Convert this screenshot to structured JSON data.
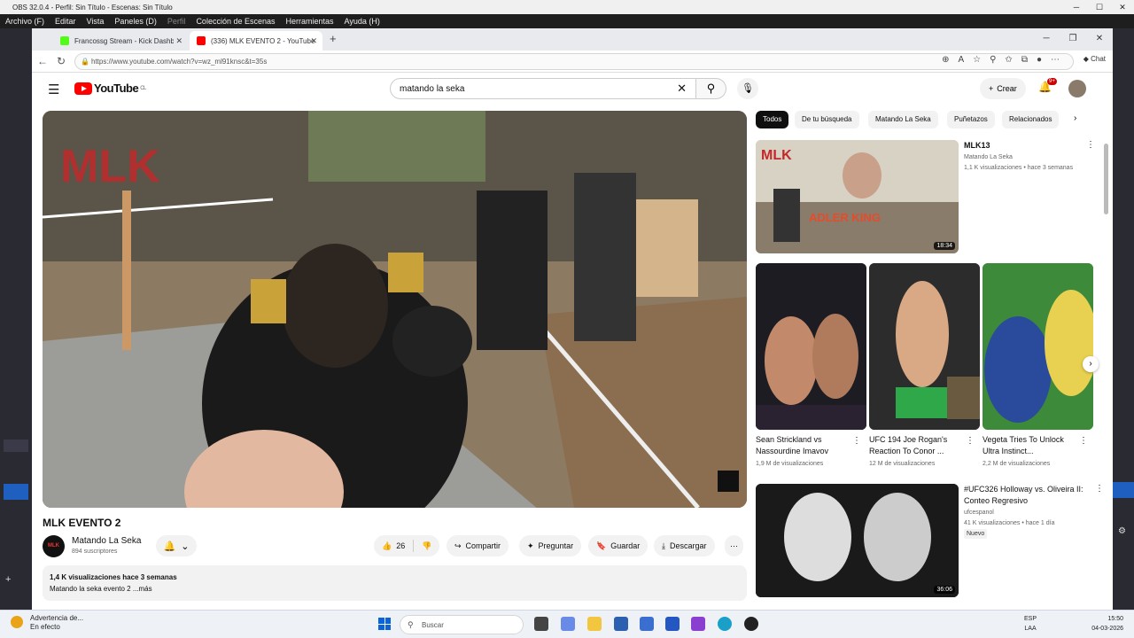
{
  "obs": {
    "title": "OBS 32.0.4 - Perfil: Sin Título - Escenas: Sin Título",
    "menu": [
      "Archivo (F)",
      "Editar",
      "Vista",
      "Paneles (D)",
      "Perfil",
      "Colección de Escenas",
      "Herramientas",
      "Ayuda (H)"
    ]
  },
  "browser": {
    "tabs": [
      {
        "label": "Francossg Stream - Kick Dashboard",
        "favicon_color": "#53fc18"
      },
      {
        "label": "(336) MLK EVENTO 2 - YouTube",
        "favicon_color": "#ff0000"
      }
    ],
    "url": "https://www.youtube.com/watch?v=wz_ml91knsc&t=35s",
    "copilot_label": "Chat"
  },
  "youtube": {
    "logo_text": "YouTube",
    "logo_region": "CL",
    "search_value": "matando la seka",
    "create_label": "Crear",
    "notifications_badge": "9+",
    "video": {
      "title": "MLK EVENTO 2",
      "watermark": "MLK",
      "channel": "Matando La Seka",
      "subscribers": "894 suscriptores",
      "likes": "26",
      "share_label": "Compartir",
      "ask_label": "Preguntar",
      "save_label": "Guardar",
      "download_label": "Descargar",
      "views_date": "1,4 K visualizaciones  hace 3 semanas",
      "description": "Matando la seka evento 2 ...más"
    },
    "chips": [
      "Todos",
      "De tu búsqueda",
      "Matando La Seka",
      "Puñetazos",
      "Relacionados"
    ],
    "recommendations": {
      "first": {
        "title": "MLK13",
        "channel": "Matando La Seka",
        "meta": "1,1 K visualizaciones • hace 3 semanas",
        "duration": "18:34",
        "thumb_text": "ADLER KING"
      },
      "shorts": [
        {
          "title": "Sean Strickland vs Nassourdine Imavov",
          "meta": "1,9 M de visualizaciones"
        },
        {
          "title": "UFC 194 Joe Rogan's Reaction To Conor ...",
          "meta": "12 M de visualizaciones"
        },
        {
          "title": "Vegeta Tries To Unlock Ultra Instinct...",
          "meta": "2,2 M de visualizaciones"
        }
      ],
      "third": {
        "title": "#UFC326 Holloway vs. Oliveira II: Conteo Regresivo",
        "channel": "ufcespanol",
        "meta": "41 K visualizaciones • hace 1 día",
        "badge": "Nuevo",
        "duration": "36:06"
      }
    }
  },
  "taskbar": {
    "warning_title": "Advertencia de...",
    "warning_sub": "En efecto",
    "search_placeholder": "Buscar",
    "lang_top": "ESP",
    "lang_bottom": "LAA",
    "time": "15:50",
    "date": "04-03-2026"
  }
}
